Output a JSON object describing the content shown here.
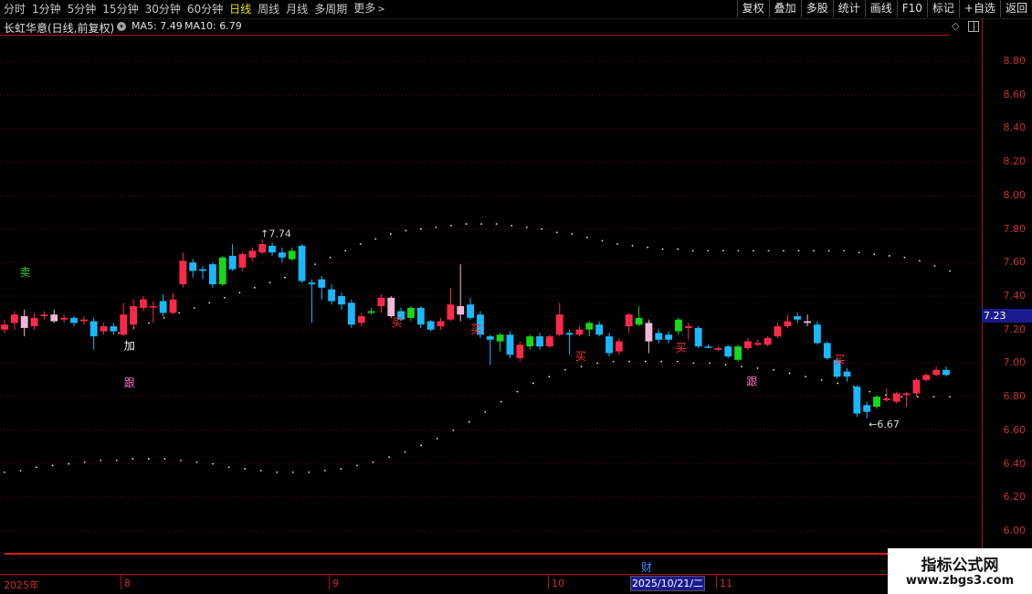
{
  "toolbar": {
    "tabs": [
      "分时",
      "1分钟",
      "5分钟",
      "15分钟",
      "30分钟",
      "60分钟",
      "日线",
      "周线",
      "月线",
      "多周期",
      "更多"
    ],
    "active_tab": "日线",
    "tools": [
      "复权",
      "叠加",
      "多股",
      "统计",
      "画线",
      "F10",
      "标记",
      "+自选",
      "返回"
    ]
  },
  "title": {
    "stock": "长虹华意(日线,前复权)",
    "ma5": "MA5: 7.49",
    "ma10": "MA10: 6.79"
  },
  "axis": {
    "ticks": [
      "8.80",
      "8.60",
      "8.40",
      "8.20",
      "8.00",
      "7.80",
      "7.60",
      "7.40",
      "7.20",
      "7.00",
      "6.80",
      "6.60",
      "6.40",
      "6.20",
      "6.00"
    ],
    "current_price": "7.23"
  },
  "dates": {
    "labels": [
      "2025年",
      "8",
      "9",
      "10",
      "11"
    ],
    "cursor": "2025/10/21/二",
    "event": "财"
  },
  "annotations": {
    "high": "7.74",
    "low": "6.67",
    "signals": [
      {
        "text": "卖",
        "color": "#30d030"
      },
      {
        "text": "加",
        "color": "#ffffff"
      },
      {
        "text": "跟",
        "color": "#ff70c0"
      },
      {
        "text": "买",
        "color": "#ff3030"
      },
      {
        "text": "买",
        "color": "#ff3030"
      },
      {
        "text": "买",
        "color": "#ff3030"
      },
      {
        "text": "买",
        "color": "#ff3030"
      },
      {
        "text": "跟",
        "color": "#ff70c0"
      },
      {
        "text": "买",
        "color": "#ff3030"
      }
    ]
  },
  "watermark": {
    "line1": "指标公式网",
    "line2": "www.zbgs3.com"
  },
  "chart_data": {
    "type": "candlestick",
    "ylim": [
      5.95,
      8.95
    ],
    "candles": [
      {
        "o": 7.2,
        "c": 7.23,
        "h": 7.26,
        "l": 7.18,
        "k": "up"
      },
      {
        "o": 7.24,
        "c": 7.29,
        "h": 7.31,
        "l": 7.2,
        "k": "up"
      },
      {
        "o": 7.28,
        "c": 7.21,
        "h": 7.32,
        "l": 7.16,
        "k": "pale"
      },
      {
        "o": 7.22,
        "c": 7.27,
        "h": 7.3,
        "l": 7.2,
        "k": "up"
      },
      {
        "o": 7.29,
        "c": 7.28,
        "h": 7.31,
        "l": 7.26,
        "k": "up"
      },
      {
        "o": 7.29,
        "c": 7.25,
        "h": 7.32,
        "l": 7.24,
        "k": "pale"
      },
      {
        "o": 7.26,
        "c": 7.27,
        "h": 7.29,
        "l": 7.24,
        "k": "up"
      },
      {
        "o": 7.27,
        "c": 7.24,
        "h": 7.28,
        "l": 7.22,
        "k": "down"
      },
      {
        "o": 7.25,
        "c": 7.26,
        "h": 7.28,
        "l": 7.23,
        "k": "up"
      },
      {
        "o": 7.25,
        "c": 7.16,
        "h": 7.27,
        "l": 7.08,
        "k": "down"
      },
      {
        "o": 7.19,
        "c": 7.22,
        "h": 7.24,
        "l": 7.17,
        "k": "up"
      },
      {
        "o": 7.22,
        "c": 7.19,
        "h": 7.24,
        "l": 7.17,
        "k": "down"
      },
      {
        "o": 7.17,
        "c": 7.29,
        "h": 7.36,
        "l": 7.16,
        "k": "up"
      },
      {
        "o": 7.23,
        "c": 7.34,
        "h": 7.38,
        "l": 7.2,
        "k": "up"
      },
      {
        "o": 7.33,
        "c": 7.38,
        "h": 7.4,
        "l": 7.31,
        "k": "up"
      },
      {
        "o": 7.34,
        "c": 7.34,
        "h": 7.37,
        "l": 7.24,
        "k": "up"
      },
      {
        "o": 7.37,
        "c": 7.3,
        "h": 7.41,
        "l": 7.28,
        "k": "down"
      },
      {
        "o": 7.3,
        "c": 7.38,
        "h": 7.42,
        "l": 7.29,
        "k": "up"
      },
      {
        "o": 7.47,
        "c": 7.61,
        "h": 7.66,
        "l": 7.45,
        "k": "up"
      },
      {
        "o": 7.6,
        "c": 7.55,
        "h": 7.62,
        "l": 7.51,
        "k": "down"
      },
      {
        "o": 7.55,
        "c": 7.56,
        "h": 7.58,
        "l": 7.5,
        "k": "down"
      },
      {
        "o": 7.59,
        "c": 7.47,
        "h": 7.6,
        "l": 7.45,
        "k": "down"
      },
      {
        "o": 7.47,
        "c": 7.63,
        "h": 7.64,
        "l": 7.46,
        "k": "green"
      },
      {
        "o": 7.64,
        "c": 7.56,
        "h": 7.71,
        "l": 7.55,
        "k": "down"
      },
      {
        "o": 7.57,
        "c": 7.65,
        "h": 7.66,
        "l": 7.55,
        "k": "up"
      },
      {
        "o": 7.63,
        "c": 7.67,
        "h": 7.69,
        "l": 7.61,
        "k": "up"
      },
      {
        "o": 7.66,
        "c": 7.71,
        "h": 7.74,
        "l": 7.65,
        "k": "up"
      },
      {
        "o": 7.7,
        "c": 7.66,
        "h": 7.72,
        "l": 7.64,
        "k": "down"
      },
      {
        "o": 7.66,
        "c": 7.63,
        "h": 7.69,
        "l": 7.6,
        "k": "down"
      },
      {
        "o": 7.62,
        "c": 7.67,
        "h": 7.69,
        "l": 7.61,
        "k": "green"
      },
      {
        "o": 7.7,
        "c": 7.49,
        "h": 7.71,
        "l": 7.48,
        "k": "down"
      },
      {
        "o": 7.48,
        "c": 7.47,
        "h": 7.5,
        "l": 7.24,
        "k": "down"
      },
      {
        "o": 7.5,
        "c": 7.45,
        "h": 7.52,
        "l": 7.38,
        "k": "down"
      },
      {
        "o": 7.44,
        "c": 7.37,
        "h": 7.47,
        "l": 7.35,
        "k": "down"
      },
      {
        "o": 7.4,
        "c": 7.35,
        "h": 7.42,
        "l": 7.32,
        "k": "down"
      },
      {
        "o": 7.36,
        "c": 7.23,
        "h": 7.38,
        "l": 7.21,
        "k": "down"
      },
      {
        "o": 7.24,
        "c": 7.28,
        "h": 7.3,
        "l": 7.22,
        "k": "up"
      },
      {
        "o": 7.3,
        "c": 7.31,
        "h": 7.33,
        "l": 7.29,
        "k": "green"
      },
      {
        "o": 7.34,
        "c": 7.39,
        "h": 7.41,
        "l": 7.3,
        "k": "up"
      },
      {
        "o": 7.39,
        "c": 7.28,
        "h": 7.4,
        "l": 7.27,
        "k": "pale"
      },
      {
        "o": 7.31,
        "c": 7.26,
        "h": 7.33,
        "l": 7.25,
        "k": "down"
      },
      {
        "o": 7.27,
        "c": 7.33,
        "h": 7.34,
        "l": 7.25,
        "k": "green"
      },
      {
        "o": 7.33,
        "c": 7.23,
        "h": 7.34,
        "l": 7.21,
        "k": "down"
      },
      {
        "o": 7.25,
        "c": 7.2,
        "h": 7.26,
        "l": 7.19,
        "k": "down"
      },
      {
        "o": 7.22,
        "c": 7.25,
        "h": 7.27,
        "l": 7.2,
        "k": "up"
      },
      {
        "o": 7.26,
        "c": 7.35,
        "h": 7.45,
        "l": 7.25,
        "k": "up"
      },
      {
        "o": 7.34,
        "c": 7.29,
        "h": 7.59,
        "l": 7.25,
        "k": "pale"
      },
      {
        "o": 7.35,
        "c": 7.27,
        "h": 7.39,
        "l": 7.26,
        "k": "down"
      },
      {
        "o": 7.29,
        "c": 7.17,
        "h": 7.31,
        "l": 7.15,
        "k": "down"
      },
      {
        "o": 7.14,
        "c": 7.16,
        "h": 7.17,
        "l": 6.99,
        "k": "down"
      },
      {
        "o": 7.13,
        "c": 7.17,
        "h": 7.18,
        "l": 7.07,
        "k": "green"
      },
      {
        "o": 7.17,
        "c": 7.05,
        "h": 7.19,
        "l": 7.03,
        "k": "down"
      },
      {
        "o": 7.03,
        "c": 7.11,
        "h": 7.13,
        "l": 7.01,
        "k": "up"
      },
      {
        "o": 7.1,
        "c": 7.16,
        "h": 7.17,
        "l": 7.08,
        "k": "green"
      },
      {
        "o": 7.16,
        "c": 7.1,
        "h": 7.18,
        "l": 7.08,
        "k": "down"
      },
      {
        "o": 7.1,
        "c": 7.16,
        "h": 7.17,
        "l": 7.09,
        "k": "up"
      },
      {
        "o": 7.17,
        "c": 7.29,
        "h": 7.36,
        "l": 7.16,
        "k": "up"
      },
      {
        "o": 7.18,
        "c": 7.17,
        "h": 7.2,
        "l": 7.05,
        "k": "down"
      },
      {
        "o": 7.2,
        "c": 7.17,
        "h": 7.22,
        "l": 7.16,
        "k": "up"
      },
      {
        "o": 7.2,
        "c": 7.24,
        "h": 7.25,
        "l": 7.16,
        "k": "green"
      },
      {
        "o": 7.23,
        "c": 7.17,
        "h": 7.25,
        "l": 7.16,
        "k": "down"
      },
      {
        "o": 7.16,
        "c": 7.06,
        "h": 7.18,
        "l": 7.04,
        "k": "down"
      },
      {
        "o": 7.07,
        "c": 7.13,
        "h": 7.15,
        "l": 7.05,
        "k": "up"
      },
      {
        "o": 7.22,
        "c": 7.29,
        "h": 7.3,
        "l": 7.18,
        "k": "up"
      },
      {
        "o": 7.23,
        "c": 7.27,
        "h": 7.34,
        "l": 7.22,
        "k": "green"
      },
      {
        "o": 7.24,
        "c": 7.13,
        "h": 7.26,
        "l": 7.06,
        "k": "pale"
      },
      {
        "o": 7.18,
        "c": 7.14,
        "h": 7.2,
        "l": 7.12,
        "k": "down"
      },
      {
        "o": 7.14,
        "c": 7.17,
        "h": 7.19,
        "l": 7.12,
        "k": "down"
      },
      {
        "o": 7.26,
        "c": 7.19,
        "h": 7.27,
        "l": 7.17,
        "k": "green"
      },
      {
        "o": 7.22,
        "c": 7.21,
        "h": 7.24,
        "l": 7.14,
        "k": "up"
      },
      {
        "o": 7.21,
        "c": 7.1,
        "h": 7.22,
        "l": 7.09,
        "k": "down"
      },
      {
        "o": 7.1,
        "c": 7.1,
        "h": 7.11,
        "l": 7.09,
        "k": "down"
      },
      {
        "o": 7.08,
        "c": 7.09,
        "h": 7.1,
        "l": 7.07,
        "k": "up"
      },
      {
        "o": 7.1,
        "c": 7.04,
        "h": 7.11,
        "l": 7.03,
        "k": "down"
      },
      {
        "o": 7.02,
        "c": 7.1,
        "h": 7.11,
        "l": 7.01,
        "k": "green"
      },
      {
        "o": 7.09,
        "c": 7.13,
        "h": 7.15,
        "l": 7.08,
        "k": "up"
      },
      {
        "o": 7.11,
        "c": 7.12,
        "h": 7.14,
        "l": 7.1,
        "k": "up"
      },
      {
        "o": 7.11,
        "c": 7.15,
        "h": 7.16,
        "l": 7.1,
        "k": "up"
      },
      {
        "o": 7.16,
        "c": 7.22,
        "h": 7.24,
        "l": 7.15,
        "k": "up"
      },
      {
        "o": 7.22,
        "c": 7.25,
        "h": 7.29,
        "l": 7.21,
        "k": "up"
      },
      {
        "o": 7.28,
        "c": 7.26,
        "h": 7.3,
        "l": 7.24,
        "k": "down"
      },
      {
        "o": 7.25,
        "c": 7.24,
        "h": 7.29,
        "l": 7.22,
        "k": "pale"
      },
      {
        "o": 7.23,
        "c": 7.12,
        "h": 7.25,
        "l": 7.11,
        "k": "down"
      },
      {
        "o": 7.12,
        "c": 7.03,
        "h": 7.13,
        "l": 7.02,
        "k": "down"
      },
      {
        "o": 7.02,
        "c": 6.92,
        "h": 7.03,
        "l": 6.91,
        "k": "down"
      },
      {
        "o": 6.95,
        "c": 6.92,
        "h": 6.97,
        "l": 6.89,
        "k": "down"
      },
      {
        "o": 6.86,
        "c": 6.7,
        "h": 6.87,
        "l": 6.68,
        "k": "down"
      },
      {
        "o": 6.71,
        "c": 6.75,
        "h": 6.77,
        "l": 6.67,
        "k": "down"
      },
      {
        "o": 6.74,
        "c": 6.8,
        "h": 6.81,
        "l": 6.73,
        "k": "green"
      },
      {
        "o": 6.78,
        "c": 6.79,
        "h": 6.85,
        "l": 6.77,
        "k": "up"
      },
      {
        "o": 6.77,
        "c": 6.82,
        "h": 6.83,
        "l": 6.76,
        "k": "up"
      },
      {
        "o": 6.82,
        "c": 6.81,
        "h": 6.83,
        "l": 6.74,
        "k": "up"
      },
      {
        "o": 6.82,
        "c": 6.9,
        "h": 6.91,
        "l": 6.8,
        "k": "up"
      },
      {
        "o": 6.9,
        "c": 6.93,
        "h": 6.94,
        "l": 6.89,
        "k": "up"
      },
      {
        "o": 6.93,
        "c": 6.96,
        "h": 6.98,
        "l": 6.92,
        "k": "up"
      },
      {
        "o": 6.96,
        "c": 6.93,
        "h": 6.98,
        "l": 6.92,
        "k": "down"
      }
    ],
    "ma_upper": [
      7.18,
      7.21,
      7.24,
      7.27,
      7.3,
      7.33,
      7.36,
      7.39,
      7.42,
      7.45,
      7.48,
      7.51,
      7.55,
      7.59,
      7.63,
      7.67,
      7.71,
      7.74,
      7.77,
      7.79,
      7.8,
      7.81,
      7.82,
      7.83,
      7.83,
      7.83,
      7.82,
      7.81,
      7.8,
      7.78,
      7.77,
      7.75,
      7.73,
      7.71,
      7.7,
      7.69,
      7.68,
      7.68,
      7.67,
      7.67,
      7.67,
      7.67,
      7.67,
      7.67,
      7.67,
      7.67,
      7.67,
      7.67,
      7.67,
      7.66,
      7.65,
      7.64,
      7.63,
      7.61,
      7.58,
      7.55
    ],
    "ma_lower": [
      6.35,
      6.36,
      6.38,
      6.39,
      6.4,
      6.41,
      6.42,
      6.42,
      6.43,
      6.43,
      6.43,
      6.42,
      6.41,
      6.4,
      6.38,
      6.37,
      6.36,
      6.35,
      6.35,
      6.35,
      6.36,
      6.37,
      6.39,
      6.41,
      6.44,
      6.47,
      6.51,
      6.55,
      6.6,
      6.65,
      6.71,
      6.77,
      6.83,
      6.88,
      6.92,
      6.96,
      6.98,
      7.0,
      7.01,
      7.01,
      7.01,
      7.01,
      7.01,
      7.0,
      7.0,
      6.99,
      6.98,
      6.97,
      6.96,
      6.94,
      6.92,
      6.9,
      6.88,
      6.86,
      6.83,
      6.81,
      6.8,
      6.8,
      6.8,
      6.8
    ]
  }
}
